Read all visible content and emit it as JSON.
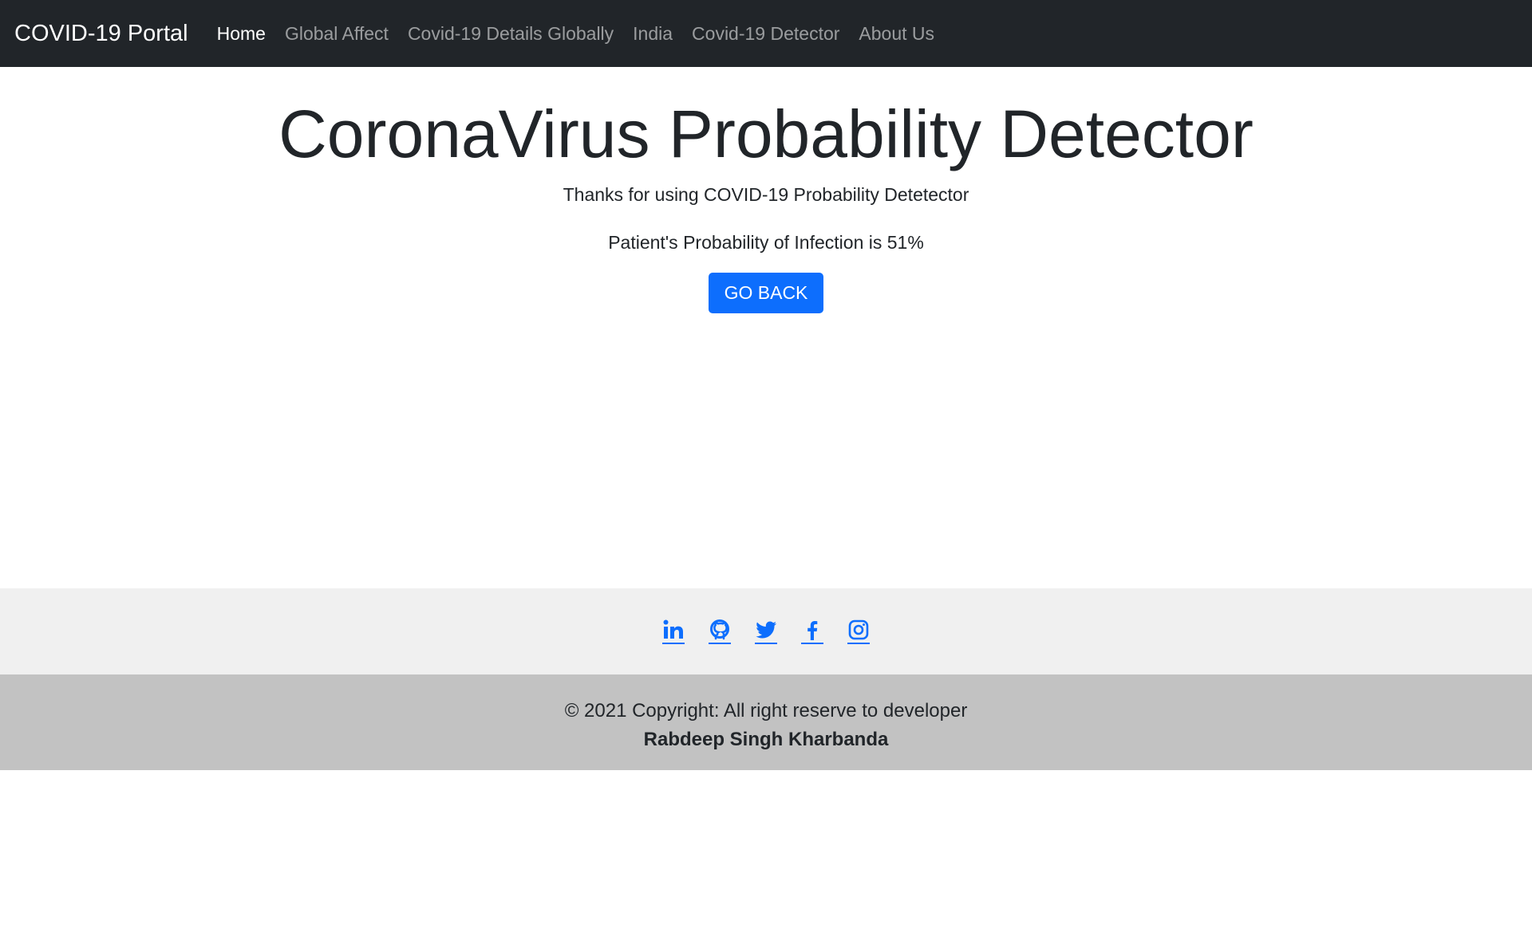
{
  "navbar": {
    "brand": "COVID-19 Portal",
    "links": [
      {
        "label": "Home",
        "active": true
      },
      {
        "label": "Global Affect",
        "active": false
      },
      {
        "label": "Covid-19 Details Globally",
        "active": false
      },
      {
        "label": "India",
        "active": false
      },
      {
        "label": "Covid-19 Detector",
        "active": false
      },
      {
        "label": "About Us",
        "active": false
      }
    ]
  },
  "main": {
    "title": "CoronaVirus Probability Detector",
    "thanks": "Thanks for using COVID-19 Probability Detetector",
    "result": "Patient's Probability of Infection is 51%",
    "button_label": "GO BACK"
  },
  "social": {
    "icons": [
      "linkedin-icon",
      "github-icon",
      "twitter-icon",
      "facebook-icon",
      "instagram-icon"
    ]
  },
  "footer": {
    "copyright": "© 2021 Copyright: All right reserve to developer",
    "developer": "Rabdeep Singh Kharbanda"
  },
  "colors": {
    "navbar_bg": "#212529",
    "accent": "#0d6efd",
    "social_bg": "#f0f0f0",
    "footer_bg": "#c2c2c2"
  }
}
